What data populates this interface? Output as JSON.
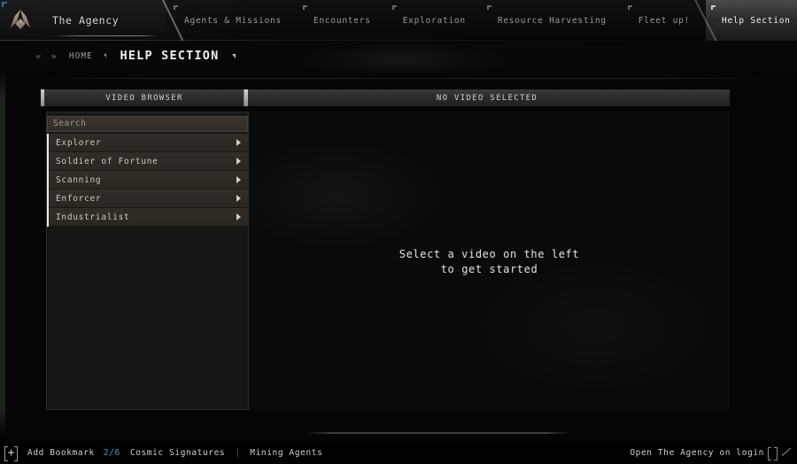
{
  "colors": {
    "accent_cyan": "#3a9fd8",
    "active_tab_bg": "#3a3a3a",
    "list_item_bg": "#332d28",
    "logo_corner": "#2b6fa8"
  },
  "header": {
    "logo_icon": "agency-emblem-icon",
    "brand": "The Agency",
    "tabs": [
      {
        "label": "Agents & Missions",
        "active": false
      },
      {
        "label": "Encounters",
        "active": false
      },
      {
        "label": "Exploration",
        "active": false
      },
      {
        "label": "Resource Harvesting",
        "active": false
      },
      {
        "label": "Fleet up!",
        "active": false
      },
      {
        "label": "Help Section",
        "active": true
      }
    ]
  },
  "breadcrumb": {
    "back_forward": "«  »",
    "home": "HOME",
    "current": "HELP SECTION"
  },
  "browser_panel": {
    "header_title": "VIDEO BROWSER",
    "search": {
      "placeholder": "Search",
      "value": ""
    },
    "items": [
      {
        "label": "Explorer",
        "chevron": "chevron-right-icon"
      },
      {
        "label": "Soldier of Fortune",
        "chevron": "chevron-right-icon"
      },
      {
        "label": "Scanning",
        "chevron": "chevron-right-icon"
      },
      {
        "label": "Enforcer",
        "chevron": "chevron-right-icon"
      },
      {
        "label": "Industrialist",
        "chevron": "chevron-right-icon"
      }
    ]
  },
  "detail_panel": {
    "header_title": "NO VIDEO SELECTED",
    "message_line1": "Select a video on the left",
    "message_line2": "to get started"
  },
  "bottom_bar": {
    "add_bookmark_icon": "plus-icon",
    "add_bookmark_label": "Add Bookmark",
    "bookmark_count": "2/6",
    "bookmarks": [
      {
        "label": "Cosmic Signatures"
      },
      {
        "label": "Mining Agents"
      }
    ],
    "separator": "|",
    "login_option_label": "Open The Agency on login",
    "login_option_checked": false,
    "resize_icon": "resize-grip-icon"
  }
}
